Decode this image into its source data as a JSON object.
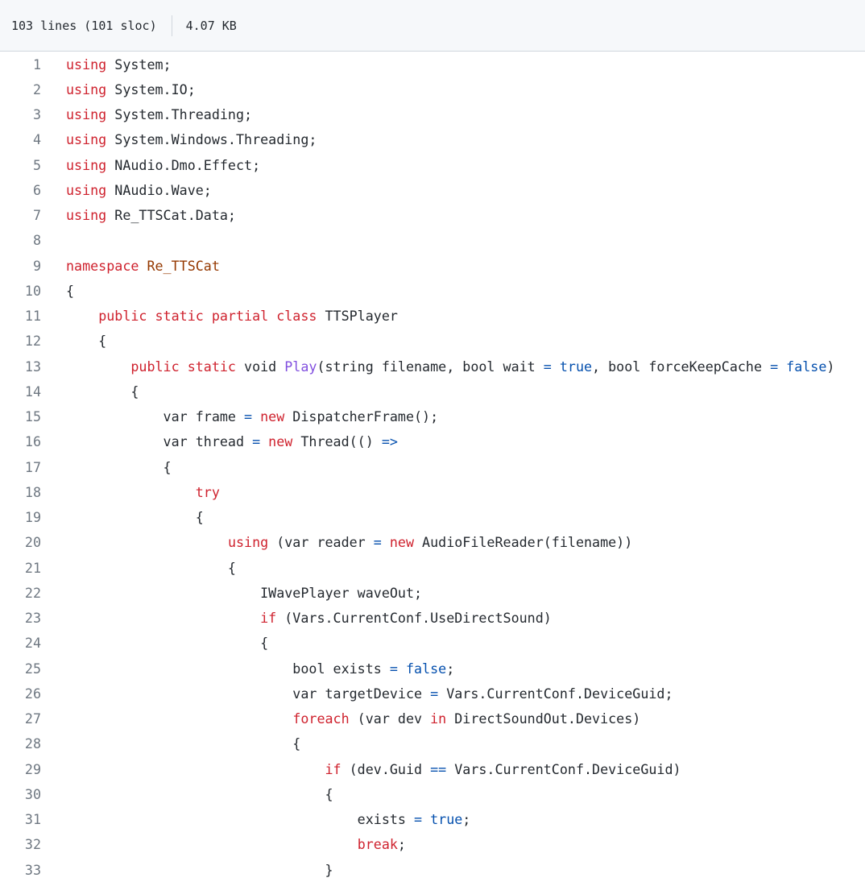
{
  "file_info": {
    "lines": "103 lines (101 sloc)",
    "size": "4.07 KB"
  },
  "code_lines": [
    {
      "n": "1",
      "tokens": [
        [
          "kw",
          "using"
        ],
        [
          "",
          " System;"
        ]
      ]
    },
    {
      "n": "2",
      "tokens": [
        [
          "kw",
          "using"
        ],
        [
          "",
          " System.IO;"
        ]
      ]
    },
    {
      "n": "3",
      "tokens": [
        [
          "kw",
          "using"
        ],
        [
          "",
          " System.Threading;"
        ]
      ]
    },
    {
      "n": "4",
      "tokens": [
        [
          "kw",
          "using"
        ],
        [
          "",
          " System.Windows.Threading;"
        ]
      ]
    },
    {
      "n": "5",
      "tokens": [
        [
          "kw",
          "using"
        ],
        [
          "",
          " NAudio.Dmo.Effect;"
        ]
      ]
    },
    {
      "n": "6",
      "tokens": [
        [
          "kw",
          "using"
        ],
        [
          "",
          " NAudio.Wave;"
        ]
      ]
    },
    {
      "n": "7",
      "tokens": [
        [
          "kw",
          "using"
        ],
        [
          "",
          " Re_TTSCat.Data;"
        ]
      ]
    },
    {
      "n": "8",
      "tokens": []
    },
    {
      "n": "9",
      "tokens": [
        [
          "kw",
          "namespace"
        ],
        [
          "",
          " "
        ],
        [
          "tn",
          "Re_TTSCat"
        ]
      ]
    },
    {
      "n": "10",
      "tokens": [
        [
          "",
          "{"
        ]
      ]
    },
    {
      "n": "11",
      "tokens": [
        [
          "",
          "    "
        ],
        [
          "kw",
          "public"
        ],
        [
          "",
          " "
        ],
        [
          "kw",
          "static"
        ],
        [
          "",
          " "
        ],
        [
          "kw",
          "partial"
        ],
        [
          "",
          " "
        ],
        [
          "kw",
          "class"
        ],
        [
          "",
          " TTSPlayer"
        ]
      ]
    },
    {
      "n": "12",
      "tokens": [
        [
          "",
          "    {"
        ]
      ]
    },
    {
      "n": "13",
      "tokens": [
        [
          "",
          "        "
        ],
        [
          "kw",
          "public"
        ],
        [
          "",
          " "
        ],
        [
          "kw",
          "static"
        ],
        [
          "",
          " void "
        ],
        [
          "fn",
          "Play"
        ],
        [
          "",
          "(string filename, bool wait "
        ],
        [
          "op",
          "="
        ],
        [
          "",
          " "
        ],
        [
          "lit",
          "true"
        ],
        [
          "",
          ", bool forceKeepCache "
        ],
        [
          "op",
          "="
        ],
        [
          "",
          " "
        ],
        [
          "lit",
          "false"
        ],
        [
          "",
          ")"
        ]
      ]
    },
    {
      "n": "14",
      "tokens": [
        [
          "",
          "        {"
        ]
      ]
    },
    {
      "n": "15",
      "tokens": [
        [
          "",
          "            var frame "
        ],
        [
          "op",
          "="
        ],
        [
          "",
          " "
        ],
        [
          "kw",
          "new"
        ],
        [
          "",
          " DispatcherFrame();"
        ]
      ]
    },
    {
      "n": "16",
      "tokens": [
        [
          "",
          "            var thread "
        ],
        [
          "op",
          "="
        ],
        [
          "",
          " "
        ],
        [
          "kw",
          "new"
        ],
        [
          "",
          " Thread(() "
        ],
        [
          "op",
          "=>"
        ]
      ]
    },
    {
      "n": "17",
      "tokens": [
        [
          "",
          "            {"
        ]
      ]
    },
    {
      "n": "18",
      "tokens": [
        [
          "",
          "                "
        ],
        [
          "kw",
          "try"
        ]
      ]
    },
    {
      "n": "19",
      "tokens": [
        [
          "",
          "                {"
        ]
      ]
    },
    {
      "n": "20",
      "tokens": [
        [
          "",
          "                    "
        ],
        [
          "kw",
          "using"
        ],
        [
          "",
          " (var reader "
        ],
        [
          "op",
          "="
        ],
        [
          "",
          " "
        ],
        [
          "kw",
          "new"
        ],
        [
          "",
          " AudioFileReader(filename))"
        ]
      ]
    },
    {
      "n": "21",
      "tokens": [
        [
          "",
          "                    {"
        ]
      ]
    },
    {
      "n": "22",
      "tokens": [
        [
          "",
          "                        IWavePlayer waveOut;"
        ]
      ]
    },
    {
      "n": "23",
      "tokens": [
        [
          "",
          "                        "
        ],
        [
          "kw",
          "if"
        ],
        [
          "",
          " (Vars.CurrentConf.UseDirectSound)"
        ]
      ]
    },
    {
      "n": "24",
      "tokens": [
        [
          "",
          "                        {"
        ]
      ]
    },
    {
      "n": "25",
      "tokens": [
        [
          "",
          "                            bool exists "
        ],
        [
          "op",
          "="
        ],
        [
          "",
          " "
        ],
        [
          "lit",
          "false"
        ],
        [
          "",
          ";"
        ]
      ]
    },
    {
      "n": "26",
      "tokens": [
        [
          "",
          "                            var targetDevice "
        ],
        [
          "op",
          "="
        ],
        [
          "",
          " Vars.CurrentConf.DeviceGuid;"
        ]
      ]
    },
    {
      "n": "27",
      "tokens": [
        [
          "",
          "                            "
        ],
        [
          "kw",
          "foreach"
        ],
        [
          "",
          " (var dev "
        ],
        [
          "kw",
          "in"
        ],
        [
          "",
          " DirectSoundOut.Devices)"
        ]
      ]
    },
    {
      "n": "28",
      "tokens": [
        [
          "",
          "                            {"
        ]
      ]
    },
    {
      "n": "29",
      "tokens": [
        [
          "",
          "                                "
        ],
        [
          "kw",
          "if"
        ],
        [
          "",
          " (dev.Guid "
        ],
        [
          "op",
          "=="
        ],
        [
          "",
          " Vars.CurrentConf.DeviceGuid)"
        ]
      ]
    },
    {
      "n": "30",
      "tokens": [
        [
          "",
          "                                {"
        ]
      ]
    },
    {
      "n": "31",
      "tokens": [
        [
          "",
          "                                    exists "
        ],
        [
          "op",
          "="
        ],
        [
          "",
          " "
        ],
        [
          "lit",
          "true"
        ],
        [
          "",
          ";"
        ]
      ]
    },
    {
      "n": "32",
      "tokens": [
        [
          "",
          "                                    "
        ],
        [
          "kw",
          "break"
        ],
        [
          "",
          ";"
        ]
      ]
    },
    {
      "n": "33",
      "tokens": [
        [
          "",
          "                                }"
        ]
      ]
    }
  ]
}
